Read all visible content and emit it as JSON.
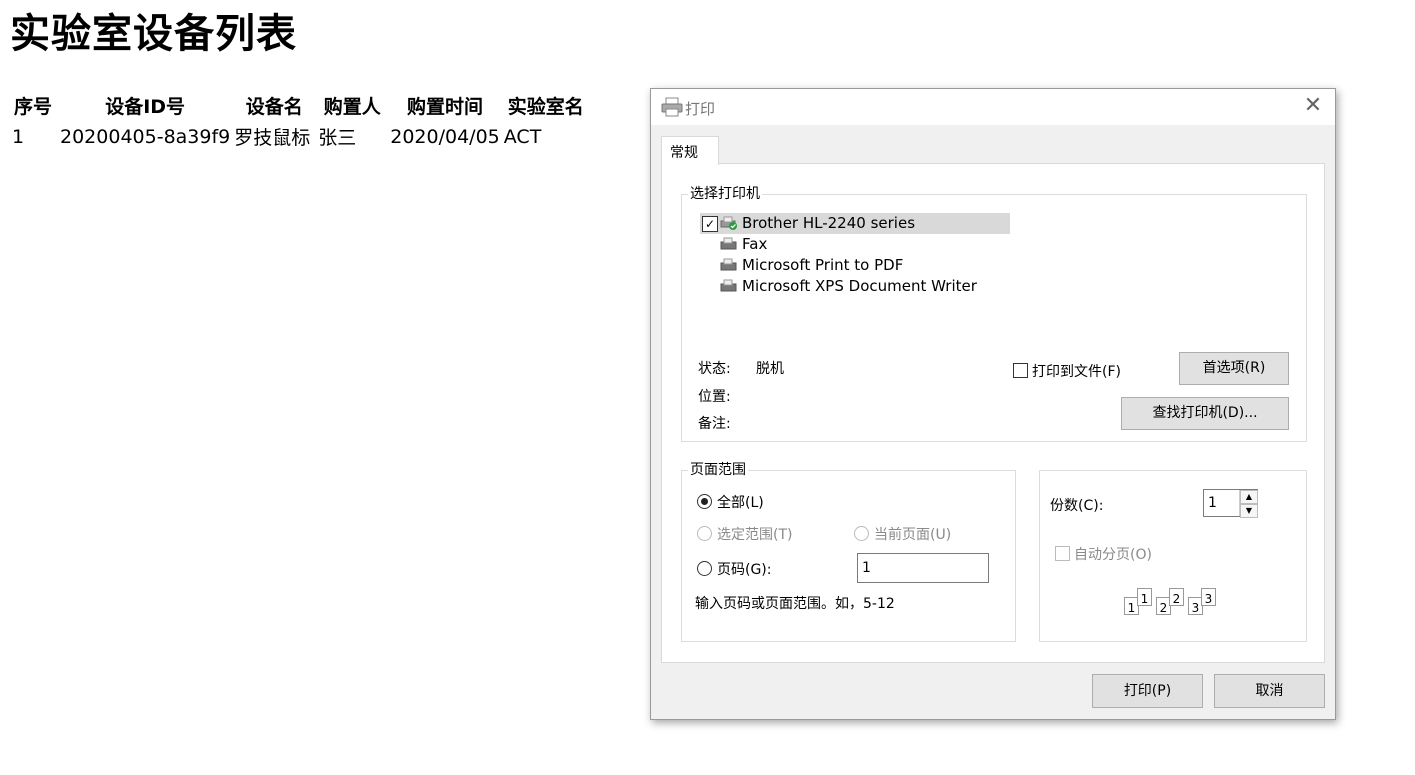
{
  "page": {
    "title": "实验室设备列表",
    "table": {
      "headers": [
        "序号",
        "设备ID号",
        "设备名",
        "购置人",
        "购置时间",
        "实验室名"
      ],
      "rows": [
        [
          "1",
          "20200405-8a39f9",
          "罗技鼠标",
          "张三",
          "2020/04/05",
          "ACT"
        ]
      ]
    }
  },
  "dialog": {
    "title": "打印",
    "close_icon": "close-icon",
    "tab": "常规",
    "printer_group": {
      "label": "选择打印机",
      "printers": [
        {
          "name": "Brother HL-2240 series",
          "selected": true,
          "icon": "printer-default-icon"
        },
        {
          "name": "Fax",
          "selected": false,
          "icon": "fax-icon"
        },
        {
          "name": "Microsoft Print to PDF",
          "selected": false,
          "icon": "printer-icon"
        },
        {
          "name": "Microsoft XPS Document Writer",
          "selected": false,
          "icon": "printer-icon"
        }
      ],
      "status_label": "状态:",
      "status_value": "脱机",
      "location_label": "位置:",
      "comment_label": "备注:",
      "print_to_file": "打印到文件(F)",
      "preferences_button": "首选项(R)",
      "find_printer_button": "查找打印机(D)..."
    },
    "range_group": {
      "label": "页面范围",
      "all": "全部(L)",
      "selection": "选定范围(T)",
      "current_page": "当前页面(U)",
      "pages": "页码(G):",
      "pages_value": "1",
      "hint": "输入页码或页面范围。如，5-12"
    },
    "copies_group": {
      "copies_label": "份数(C):",
      "copies_value": "1",
      "collate": "自动分页(O)",
      "collate_pages": [
        "1",
        "1",
        "2",
        "2",
        "3",
        "3"
      ]
    },
    "print_button": "打印(P)",
    "cancel_button": "取消"
  }
}
